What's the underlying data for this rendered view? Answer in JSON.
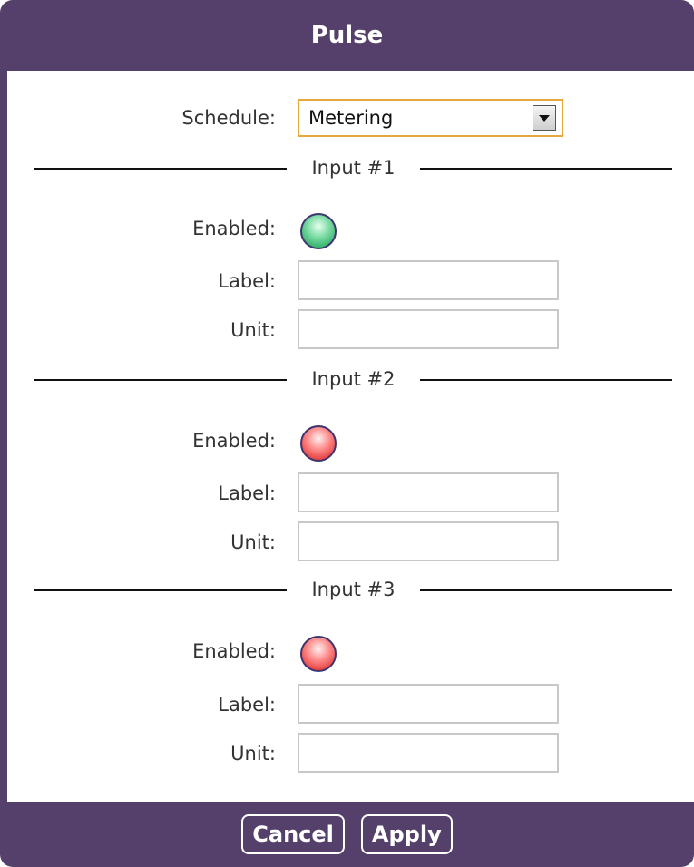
{
  "dialog": {
    "title": "Pulse",
    "cancel_label": "Cancel",
    "apply_label": "Apply"
  },
  "schedule": {
    "label": "Schedule:",
    "value": "Metering"
  },
  "inputs": [
    {
      "heading": "Input #1",
      "enabled_label": "Enabled:",
      "enabled": true,
      "label_label": "Label:",
      "label_value": "",
      "unit_label": "Unit:",
      "unit_value": ""
    },
    {
      "heading": "Input #2",
      "enabled_label": "Enabled:",
      "enabled": false,
      "label_label": "Label:",
      "label_value": "",
      "unit_label": "Unit:",
      "unit_value": ""
    },
    {
      "heading": "Input #3",
      "enabled_label": "Enabled:",
      "enabled": false,
      "label_label": "Label:",
      "label_value": "",
      "unit_label": "Unit:",
      "unit_value": ""
    }
  ],
  "colors": {
    "chrome": "#54406a",
    "select_border": "#e5a83a",
    "led_on": "#33b36b",
    "led_off": "#e5403f"
  }
}
